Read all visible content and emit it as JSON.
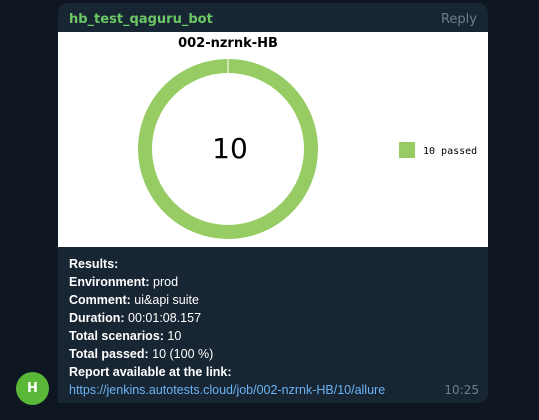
{
  "message": {
    "sender": "hb_test_qaguru_bot",
    "reply_label": "Reply",
    "time": "10:25",
    "avatar_letter": "H"
  },
  "colors": {
    "background": "#0e1621",
    "bubble": "#182533",
    "sender": "#6bc865",
    "link": "#6ab3f3",
    "muted": "#6d7f8f",
    "avatar": "#5ab838",
    "chart_green": "#97cc64"
  },
  "chart_data": {
    "type": "pie",
    "title": "002-nzrnk-HB",
    "center_label": "10",
    "slices": [
      {
        "label": "10 passed",
        "value": 10,
        "color": "#97cc64"
      }
    ],
    "legend": [
      "10 passed"
    ],
    "legend_position": "right"
  },
  "results": {
    "heading": "Results:",
    "environment_label": "Environment:",
    "environment_value": "prod",
    "comment_label": "Comment:",
    "comment_value": "ui&api suite",
    "duration_label": "Duration:",
    "duration_value": "00:01:08.157",
    "total_scenarios_label": "Total scenarios:",
    "total_scenarios_value": "10",
    "total_passed_label": "Total passed:",
    "total_passed_value": "10 (100 %)",
    "report_label": "Report available at the link:",
    "report_url": "https://jenkins.autotests.cloud/job/002-nzrnk-HB/10/allure"
  }
}
